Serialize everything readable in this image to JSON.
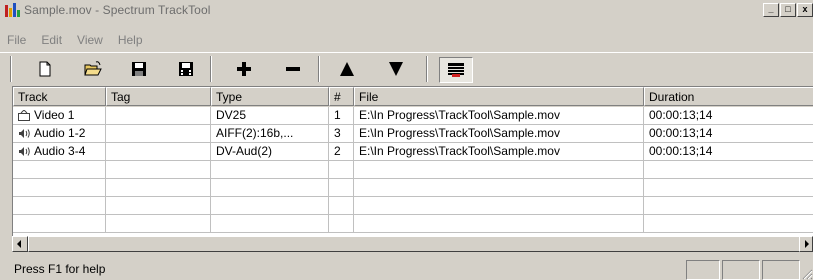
{
  "window": {
    "title": "Sample.mov - Spectrum TrackTool",
    "controls": {
      "minimize": "_",
      "maximize": "□",
      "close": "x"
    }
  },
  "menu": [
    "File",
    "Edit",
    "View",
    "Help"
  ],
  "toolbar": {
    "buttons": [
      {
        "icon": "new-document-icon"
      },
      {
        "icon": "open-folder-icon"
      },
      {
        "icon": "save-icon"
      },
      {
        "icon": "save-all-icon"
      },
      {
        "icon": "add-icon"
      },
      {
        "icon": "remove-icon"
      },
      {
        "icon": "move-up-icon"
      },
      {
        "icon": "move-down-icon"
      },
      {
        "icon": "properties-icon",
        "pressed": true
      }
    ]
  },
  "table": {
    "columns": [
      "Track",
      "Tag",
      "Type",
      "#",
      "File",
      "Duration"
    ],
    "rows": [
      {
        "icon": "video-track-icon",
        "track": "Video 1",
        "tag": "",
        "type": "DV25",
        "num": "1",
        "file": "E:\\In Progress\\TrackTool\\Sample.mov",
        "duration": "00:00:13;14"
      },
      {
        "icon": "audio-track-icon",
        "track": "Audio 1-2",
        "tag": "",
        "type": "AIFF(2):16b,...",
        "num": "3",
        "file": "E:\\In Progress\\TrackTool\\Sample.mov",
        "duration": "00:00:13;14"
      },
      {
        "icon": "audio-track-icon",
        "track": "Audio 3-4",
        "tag": "",
        "type": "DV-Aud(2)",
        "num": "2",
        "file": "E:\\In Progress\\TrackTool\\Sample.mov",
        "duration": "00:00:13;14"
      }
    ]
  },
  "status": {
    "text": "Press F1 for help"
  }
}
